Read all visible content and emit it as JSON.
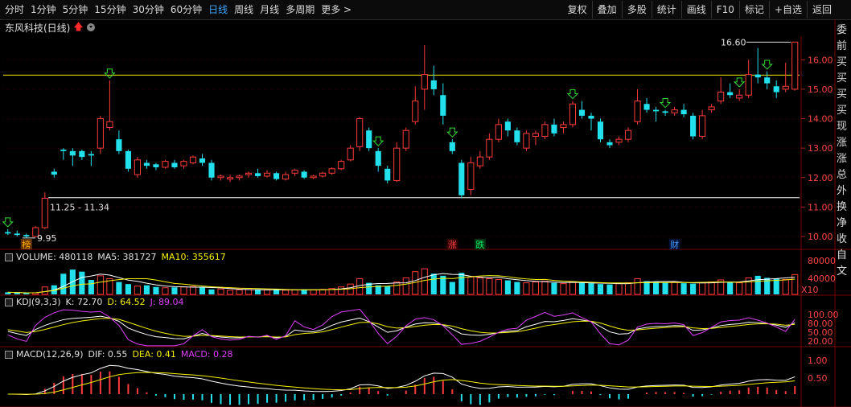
{
  "toolbar": {
    "tabs": [
      {
        "label": "分时"
      },
      {
        "label": "1分钟"
      },
      {
        "label": "5分钟"
      },
      {
        "label": "15分钟"
      },
      {
        "label": "30分钟"
      },
      {
        "label": "60分钟"
      },
      {
        "label": "日线",
        "active": true
      },
      {
        "label": "周线"
      },
      {
        "label": "月线"
      },
      {
        "label": "多周期"
      },
      {
        "label": "更多 >"
      }
    ],
    "tools": [
      {
        "label": "复权"
      },
      {
        "label": "叠加"
      },
      {
        "label": "多股"
      },
      {
        "label": "统计"
      },
      {
        "label": "画线"
      },
      {
        "label": "F10"
      },
      {
        "label": "标记"
      },
      {
        "label": "+自选"
      },
      {
        "label": "返回"
      }
    ]
  },
  "stock": {
    "name": "东风科技(日线)"
  },
  "price_axis": [
    "16.00",
    "15.00",
    "14.00",
    "13.00",
    "12.00",
    "11.00",
    "10.00"
  ],
  "annotations": {
    "high_label": "16.60",
    "range_label": "11.25 - 11.34",
    "low_label": "9.95",
    "event_markers": [
      "榜",
      "涨",
      "跌",
      "财"
    ]
  },
  "volume": {
    "label": "VOLUME: 480118",
    "ma5": "MA5: 381727",
    "ma10": "MA10: 355617",
    "axis": [
      "80000",
      "40000"
    ],
    "unit": "X10"
  },
  "kdj": {
    "label": "KDJ(9,3,3)",
    "k": "K: 72.70",
    "d": "D: 64.52",
    "j": "J: 89.04",
    "axis": [
      "100.00",
      "80.00",
      "50.00",
      "20.00"
    ]
  },
  "macd": {
    "label": "MACD(12,26,9)",
    "dif": "DIF: 0.55",
    "dea": "DEA: 0.41",
    "macd": "MACD: 0.28",
    "axis": [
      "1.00",
      "0.50"
    ]
  },
  "right_column": [
    "委",
    "前",
    "买",
    "买",
    "买",
    "买",
    "现",
    "涨",
    "涨",
    "总",
    "外",
    "换",
    "净",
    "收",
    "自",
    "文"
  ],
  "colors": {
    "up": "#ff3b3b",
    "down": "#22e0ec",
    "accent": "#3ea6ff",
    "yellow": "#f5f000",
    "magenta": "#e040fb"
  },
  "chart_data": {
    "type": "candlestick",
    "ylim": [
      9.7,
      16.8
    ],
    "candles": [
      [
        10.15,
        10.1,
        10.25,
        10.05
      ],
      [
        10.1,
        10.05,
        10.2,
        10.0
      ],
      [
        10.05,
        10.0,
        10.1,
        9.95
      ],
      [
        10.0,
        10.3,
        10.35,
        9.98
      ],
      [
        10.3,
        11.3,
        11.5,
        10.25
      ],
      [
        12.2,
        12.1,
        12.3,
        12.0
      ],
      [
        12.95,
        12.9,
        13.0,
        12.6
      ],
      [
        12.9,
        12.75,
        13.0,
        12.4
      ],
      [
        12.9,
        12.7,
        12.95,
        12.6
      ],
      [
        12.8,
        12.75,
        12.9,
        12.4
      ],
      [
        13.0,
        14.0,
        14.1,
        12.8
      ],
      [
        13.7,
        13.9,
        15.3,
        13.6
      ],
      [
        13.3,
        12.9,
        13.6,
        12.8
      ],
      [
        12.9,
        12.3,
        12.95,
        12.2
      ],
      [
        12.1,
        12.6,
        12.7,
        12.0
      ],
      [
        12.5,
        12.4,
        12.6,
        12.3
      ],
      [
        12.45,
        12.35,
        12.5,
        12.25
      ],
      [
        12.35,
        12.55,
        12.6,
        12.3
      ],
      [
        12.5,
        12.35,
        12.6,
        12.3
      ],
      [
        12.4,
        12.55,
        12.6,
        12.3
      ],
      [
        12.5,
        12.7,
        12.75,
        12.45
      ],
      [
        12.65,
        12.5,
        12.8,
        12.4
      ],
      [
        12.5,
        12.0,
        12.6,
        11.9
      ],
      [
        12.0,
        12.05,
        12.1,
        11.9
      ],
      [
        11.95,
        12.0,
        12.1,
        11.85
      ],
      [
        12.0,
        12.05,
        12.1,
        11.9
      ],
      [
        12.1,
        12.15,
        12.2,
        12.0
      ],
      [
        12.15,
        12.05,
        12.3,
        12.0
      ],
      [
        12.05,
        12.15,
        12.25,
        12.0
      ],
      [
        12.15,
        11.95,
        12.2,
        11.9
      ],
      [
        11.95,
        12.1,
        12.2,
        11.9
      ],
      [
        12.15,
        12.25,
        12.3,
        12.05
      ],
      [
        12.2,
        12.0,
        12.25,
        11.95
      ],
      [
        12.0,
        12.05,
        12.1,
        11.95
      ],
      [
        12.05,
        12.15,
        12.2,
        12.0
      ],
      [
        12.15,
        12.3,
        12.35,
        12.1
      ],
      [
        12.3,
        12.55,
        12.6,
        12.25
      ],
      [
        12.6,
        13.0,
        13.1,
        12.55
      ],
      [
        13.05,
        14.0,
        14.05,
        12.9
      ],
      [
        13.6,
        13.0,
        13.7,
        12.9
      ],
      [
        12.9,
        12.4,
        13.0,
        12.2
      ],
      [
        12.3,
        11.9,
        12.4,
        11.8
      ],
      [
        11.9,
        13.0,
        13.2,
        11.85
      ],
      [
        13.0,
        13.6,
        13.7,
        12.9
      ],
      [
        13.9,
        14.6,
        15.1,
        13.8
      ],
      [
        15.0,
        15.5,
        16.5,
        14.3
      ],
      [
        15.3,
        15.0,
        15.8,
        14.8
      ],
      [
        14.8,
        14.1,
        15.2,
        13.8
      ],
      [
        13.2,
        12.9,
        13.3,
        12.8
      ],
      [
        12.5,
        11.4,
        12.6,
        11.3
      ],
      [
        11.6,
        12.5,
        12.7,
        11.4
      ],
      [
        12.4,
        12.7,
        12.9,
        12.3
      ],
      [
        12.7,
        13.3,
        13.5,
        12.6
      ],
      [
        13.3,
        13.8,
        14.0,
        13.2
      ],
      [
        13.9,
        13.6,
        14.0,
        13.4
      ],
      [
        13.6,
        13.2,
        13.7,
        13.1
      ],
      [
        13.0,
        13.5,
        13.6,
        12.9
      ],
      [
        13.4,
        13.5,
        13.6,
        13.1
      ],
      [
        13.4,
        13.8,
        13.9,
        13.3
      ],
      [
        13.8,
        13.5,
        14.0,
        13.4
      ],
      [
        13.7,
        13.8,
        13.9,
        13.5
      ],
      [
        13.8,
        14.5,
        14.6,
        13.7
      ],
      [
        14.3,
        14.1,
        14.6,
        14.0
      ],
      [
        14.1,
        14.0,
        14.2,
        13.6
      ],
      [
        13.9,
        13.3,
        14.0,
        13.2
      ],
      [
        13.2,
        13.1,
        13.3,
        13.0
      ],
      [
        13.2,
        13.3,
        13.4,
        13.1
      ],
      [
        13.3,
        13.6,
        13.7,
        13.2
      ],
      [
        13.9,
        14.6,
        15.0,
        13.8
      ],
      [
        14.5,
        14.3,
        14.7,
        14.2
      ],
      [
        14.3,
        14.25,
        14.4,
        13.9
      ],
      [
        14.25,
        14.2,
        14.3,
        14.1
      ],
      [
        14.2,
        14.3,
        14.4,
        14.1
      ],
      [
        14.3,
        14.15,
        14.5,
        14.05
      ],
      [
        14.1,
        13.4,
        14.2,
        13.3
      ],
      [
        13.4,
        14.1,
        14.3,
        13.3
      ],
      [
        14.3,
        14.4,
        14.5,
        14.2
      ],
      [
        14.6,
        14.9,
        15.4,
        14.5
      ],
      [
        14.9,
        14.8,
        15.2,
        14.7
      ],
      [
        14.7,
        14.8,
        15.0,
        14.6
      ],
      [
        14.8,
        15.5,
        16.0,
        14.7
      ],
      [
        15.5,
        15.4,
        16.4,
        15.2
      ],
      [
        15.4,
        15.2,
        15.6,
        15.0
      ],
      [
        15.1,
        14.9,
        15.3,
        14.7
      ],
      [
        15.0,
        15.1,
        15.9,
        14.9
      ],
      [
        15.0,
        16.6,
        16.6,
        14.95
      ]
    ],
    "volume": [
      5,
      4,
      3,
      4,
      18,
      22,
      50,
      60,
      55,
      35,
      45,
      38,
      30,
      25,
      20,
      22,
      18,
      16,
      17,
      18,
      19,
      17,
      12,
      13,
      10,
      11,
      12,
      11,
      11,
      12,
      10,
      11,
      12,
      11,
      12,
      14,
      18,
      25,
      38,
      28,
      22,
      20,
      30,
      40,
      55,
      62,
      50,
      45,
      30,
      52,
      42,
      40,
      38,
      36,
      34,
      30,
      28,
      30,
      32,
      28,
      26,
      30,
      28,
      27,
      25,
      24,
      26,
      28,
      38,
      32,
      30,
      28,
      29,
      27,
      26,
      28,
      30,
      35,
      30,
      28,
      40,
      45,
      40,
      38,
      36,
      48
    ]
  }
}
